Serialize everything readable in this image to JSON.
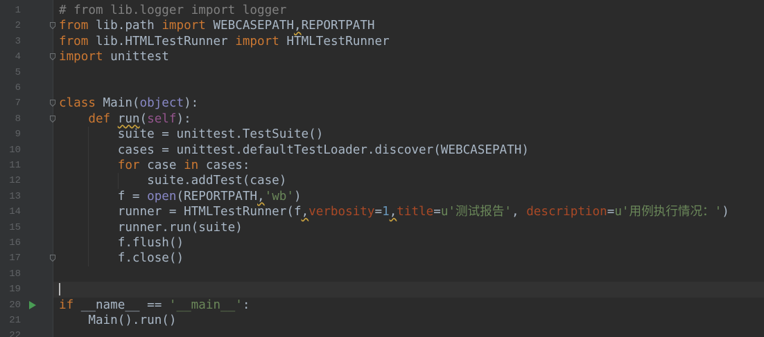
{
  "editor": {
    "lines": [
      {
        "num": "1",
        "tokens": [
          {
            "t": "# from lib.logger import logger",
            "k": "cm"
          }
        ]
      },
      {
        "num": "2",
        "tokens": [
          {
            "t": "from",
            "k": "kw"
          },
          {
            "t": " lib.path "
          },
          {
            "t": "import",
            "k": "kw"
          },
          {
            "t": " WEBCASEPATH"
          },
          {
            "t": ",",
            "k": "wv"
          },
          {
            "t": "REPORTPATH"
          }
        ]
      },
      {
        "num": "3",
        "tokens": [
          {
            "t": "from",
            "k": "kw"
          },
          {
            "t": " lib.HTMLTestRunner "
          },
          {
            "t": "import",
            "k": "kw"
          },
          {
            "t": " HTMLTestRunner"
          }
        ]
      },
      {
        "num": "4",
        "tokens": [
          {
            "t": "import",
            "k": "kw"
          },
          {
            "t": " unittest"
          }
        ]
      },
      {
        "num": "5",
        "tokens": []
      },
      {
        "num": "6",
        "tokens": []
      },
      {
        "num": "7",
        "tokens": [
          {
            "t": "class",
            "k": "kw"
          },
          {
            "t": " Main("
          },
          {
            "t": "object",
            "k": "bi"
          },
          {
            "t": "):"
          }
        ]
      },
      {
        "num": "8",
        "tokens": [
          {
            "t": "    "
          },
          {
            "t": "def",
            "k": "kw"
          },
          {
            "t": " "
          },
          {
            "t": "run",
            "k": "wv"
          },
          {
            "t": "("
          },
          {
            "t": "self",
            "k": "sf"
          },
          {
            "t": "):"
          }
        ]
      },
      {
        "num": "9",
        "tokens": [
          {
            "t": "        suite = unittest.TestSuite()"
          }
        ]
      },
      {
        "num": "10",
        "tokens": [
          {
            "t": "        cases = unittest.defaultTestLoader.discover(WEBCASEPATH)"
          }
        ]
      },
      {
        "num": "11",
        "tokens": [
          {
            "t": "        "
          },
          {
            "t": "for",
            "k": "kw"
          },
          {
            "t": " case "
          },
          {
            "t": "in",
            "k": "kw"
          },
          {
            "t": " cases:"
          }
        ]
      },
      {
        "num": "12",
        "tokens": [
          {
            "t": "            suite.addTest(case)"
          }
        ]
      },
      {
        "num": "13",
        "tokens": [
          {
            "t": "        f = "
          },
          {
            "t": "open",
            "k": "bi"
          },
          {
            "t": "(REPORTPATH"
          },
          {
            "t": ",",
            "k": "wv"
          },
          {
            "t": "'wb'",
            "k": "st"
          },
          {
            "t": ")"
          }
        ]
      },
      {
        "num": "14",
        "tokens": [
          {
            "t": "        runner = HTMLTestRunner(f"
          },
          {
            "t": ",",
            "k": "wv"
          },
          {
            "t": "verbosity",
            "k": "kwa"
          },
          {
            "t": "="
          },
          {
            "t": "1",
            "k": "nu"
          },
          {
            "t": ",",
            "k": "wv"
          },
          {
            "t": "title",
            "k": "kwa"
          },
          {
            "t": "="
          },
          {
            "t": "u'测试报告'",
            "k": "st"
          },
          {
            "t": ", "
          },
          {
            "t": "description",
            "k": "kwa"
          },
          {
            "t": "="
          },
          {
            "t": "u'用例执行情况：'",
            "k": "st"
          },
          {
            "t": ")"
          }
        ]
      },
      {
        "num": "15",
        "tokens": [
          {
            "t": "        runner.run(suite)"
          }
        ]
      },
      {
        "num": "16",
        "tokens": [
          {
            "t": "        f.flush()"
          }
        ]
      },
      {
        "num": "17",
        "tokens": [
          {
            "t": "        f.close()"
          }
        ]
      },
      {
        "num": "18",
        "tokens": []
      },
      {
        "num": "19",
        "tokens": []
      },
      {
        "num": "20",
        "tokens": [
          {
            "t": "if",
            "k": "kw"
          },
          {
            "t": " __name__ == "
          },
          {
            "t": "'__main__'",
            "k": "st"
          },
          {
            "t": ":"
          }
        ]
      },
      {
        "num": "21",
        "tokens": [
          {
            "t": "    Main().run()"
          }
        ]
      },
      {
        "num": "22",
        "tokens": []
      }
    ],
    "fold_markers": [
      "2",
      "4",
      "7",
      "8",
      "17"
    ],
    "run_marker_line": "20",
    "current_line": "19",
    "colors": {
      "background": "#2b2b2b",
      "gutter": "#313335",
      "keyword": "#cc7832",
      "comment": "#808080",
      "string": "#6a8759",
      "number": "#6897bb",
      "builtin": "#8888c6",
      "self": "#94558d",
      "keyword_arg": "#aa4926",
      "run_marker": "#499c54"
    }
  }
}
